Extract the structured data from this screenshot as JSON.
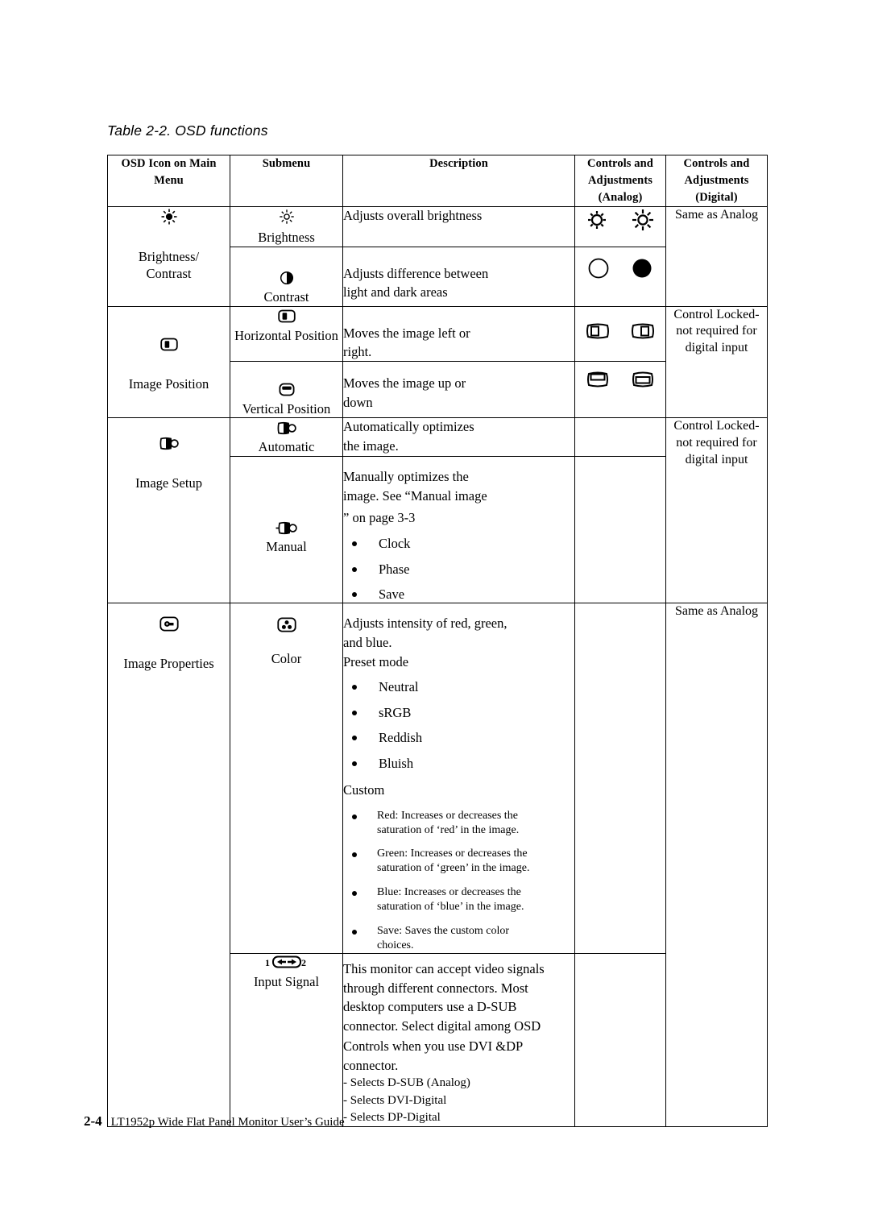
{
  "document": {
    "caption": "Table 2-2. OSD functions",
    "footer_page": "2-4",
    "footer_title": "LT1952p Wide Flat Panel Monitor User’s Guide"
  },
  "table": {
    "headers": [
      "OSD Icon on Main Menu",
      "Submenu",
      "Description",
      "Controls and Adjustments (Analog)",
      "Controls and Adjustments (Digital)"
    ],
    "headers_lines": {
      "icon": [
        "OSD Icon on Main",
        "Menu"
      ],
      "submenu": [
        "Submenu"
      ],
      "description": [
        "Description"
      ],
      "analog": [
        "Controls and",
        "Adjustments",
        "(Analog)"
      ],
      "digital": [
        "Controls and",
        "Adjustments",
        "(Digital)"
      ]
    },
    "rows": [
      {
        "main_label": "Brightness/ Contrast",
        "main_label_lines": [
          "Brightness/",
          "Contrast"
        ],
        "main_icon": "brightness-sun-icon",
        "digital": "Same as Analog",
        "subrows": [
          {
            "sub_label": "Brightness",
            "sub_icon": "sun-icon",
            "description_lines": [
              "Adjusts overall brightness"
            ],
            "analog_icons": [
              "sun-small-icon",
              "sun-large-icon"
            ]
          },
          {
            "sub_label": "Contrast",
            "sub_icon": "contrast-half-circle-icon",
            "description_lines": [
              "Adjusts difference between",
              "light and dark areas"
            ],
            "analog_icons": [
              "circle-outline-icon",
              "circle-filled-icon"
            ]
          }
        ]
      },
      {
        "main_label": "Image Position",
        "main_label_lines": [
          "Image Position"
        ],
        "main_icon": "image-position-icon",
        "digital": "Control Locked- not required for digital input",
        "digital_lines": [
          "Control Locked-",
          "not required for",
          "digital input"
        ],
        "subrows": [
          {
            "sub_label": "Horizontal Position",
            "sub_icon": "horizontal-position-icon",
            "description_lines": [
              "Moves the image left or",
              "right."
            ],
            "analog_icons": [
              "h-position-left-icon",
              "h-position-right-icon"
            ]
          },
          {
            "sub_label": "Vertical Position",
            "sub_icon": "vertical-position-icon",
            "description_lines": [
              "Moves the image up or",
              "down"
            ],
            "analog_icons": [
              "v-position-down-icon",
              "v-position-up-icon"
            ]
          }
        ]
      },
      {
        "main_label": "Image Setup",
        "main_label_lines": [
          "Image Setup"
        ],
        "main_icon": "image-setup-icon",
        "digital": "Control Locked- not required for digital input",
        "digital_lines": [
          "Control Locked-",
          "not required for",
          "digital input"
        ],
        "subrows": [
          {
            "sub_label": "Automatic",
            "sub_icon": "automatic-setup-icon",
            "description_lines": [
              "Automatically optimizes",
              "the image."
            ],
            "analog_icons": []
          },
          {
            "sub_label": "Manual",
            "sub_icon": "manual-setup-icon",
            "description_lines": [
              "Manually optimizes the",
              "image. See “Manual image",
              "” on page 3-3"
            ],
            "bullets": [
              "Clock",
              "Phase",
              "Save"
            ],
            "analog_icons": []
          }
        ]
      },
      {
        "main_label": "Image Properties",
        "main_label_lines": [
          "Image Properties"
        ],
        "main_icon": "image-properties-icon",
        "digital": "Same as Analog",
        "subrows": [
          {
            "sub_label": "Color",
            "sub_icon": "color-rgb-icon",
            "description_lines": [
              "Adjusts intensity of red, green,",
              "and blue."
            ],
            "preset_heading": "Preset mode",
            "preset_bullets": [
              "Neutral",
              "sRGB",
              "Reddish",
              "Bluish"
            ],
            "custom_heading": "Custom",
            "custom_bullets": [
              [
                "Red: Increases or decreases the",
                "saturation of  ‘red’ in the image."
              ],
              [
                "Green: Increases or decreases the",
                "saturation of ‘green’ in the image."
              ],
              [
                "Blue: Increases or decreases the",
                "saturation of ‘blue’ in the image."
              ],
              [
                "Save: Saves the custom color",
                "choices."
              ]
            ],
            "analog_icons": []
          },
          {
            "sub_label": "Input Signal",
            "sub_icon": "input-signal-icon",
            "sub_icon_labels": [
              "1",
              "2"
            ],
            "description_lines": [
              "This monitor can accept video signals",
              "through different connectors. Most",
              "desktop computers use a D-SUB",
              "connector. Select digital among OSD"
            ],
            "description_lines_2": [
              "Controls when you use DVI &DP",
              "connector."
            ],
            "selects": [
              "- Selects D-SUB (Analog)",
              "- Selects DVI-Digital",
              "- Selects DP-Digital"
            ],
            "analog_icons": []
          }
        ]
      }
    ]
  },
  "colors": {
    "text": "#000000",
    "border": "#000000",
    "background": "#ffffff"
  }
}
